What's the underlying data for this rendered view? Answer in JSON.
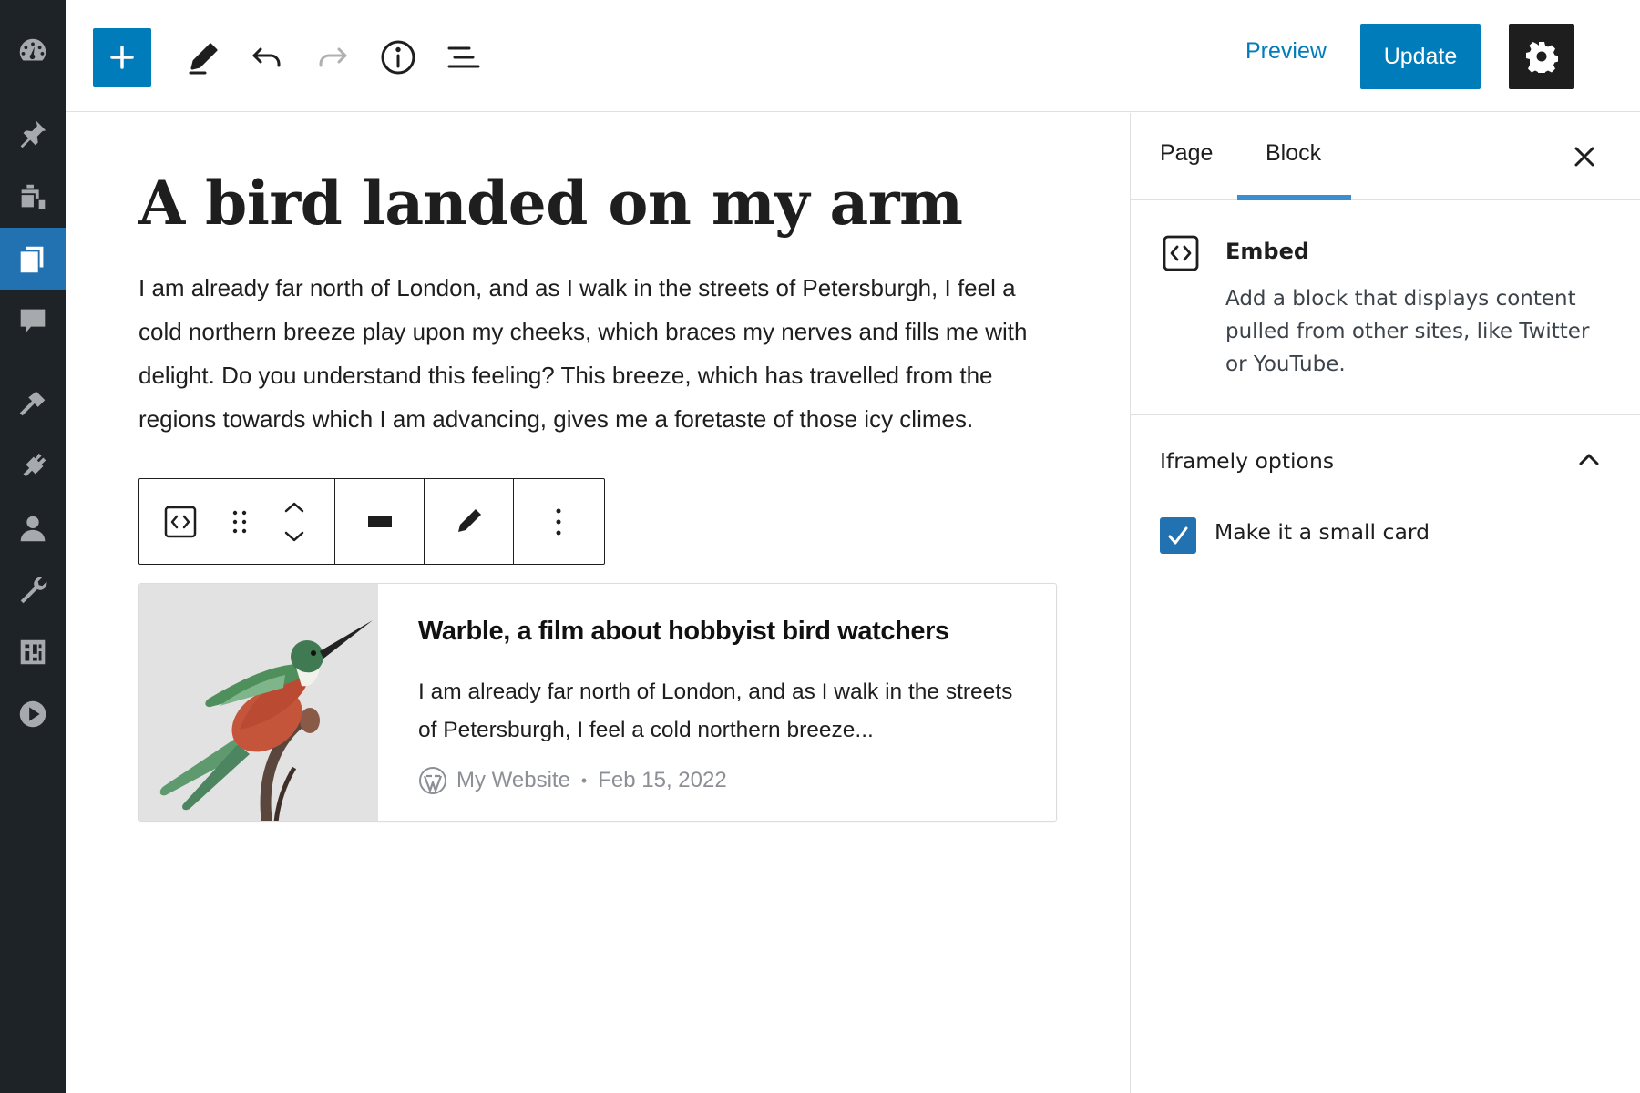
{
  "admin_menu": {
    "items": [
      {
        "name": "dashboard-icon",
        "active": false
      },
      {
        "name": "pin-icon",
        "active": false
      },
      {
        "name": "media-icon",
        "active": false
      },
      {
        "name": "pages-icon",
        "active": true
      },
      {
        "name": "comments-icon",
        "active": false
      },
      {
        "name": "appearance-icon",
        "active": false
      },
      {
        "name": "plugins-icon",
        "active": false
      },
      {
        "name": "users-icon",
        "active": false
      },
      {
        "name": "tools-icon",
        "active": false
      },
      {
        "name": "settings-icon",
        "active": false
      },
      {
        "name": "play-icon",
        "active": false
      }
    ]
  },
  "toolbar": {
    "add_icon": "plus-icon",
    "tools_icon": "pencil-icon",
    "undo_icon": "undo-icon",
    "redo_icon": "redo-icon",
    "details_icon": "info-icon",
    "outline_icon": "list-view-icon",
    "preview_label": "Preview",
    "update_label": "Update",
    "settings_icon": "gear-icon",
    "more_icon": "vertical-ellipsis-icon"
  },
  "editor": {
    "title": "A bird landed on my arm",
    "paragraph": "I am already far north of London, and as I walk in the streets of Petersburgh, I feel a cold northern breeze play upon my cheeks, which braces my nerves and fills me with delight. Do you understand this feeling? This breeze, which has travelled from the regions towards which I am advancing, gives me a foretaste of those icy climes.",
    "block_toolbar": [
      "embed-icon",
      "drag-handle-icon",
      "move-up-icon",
      "move-down-icon",
      "align-icon",
      "edit-icon",
      "more-options-icon"
    ]
  },
  "embed_card": {
    "title": "Warble, a film about hobbyist bird watchers",
    "description": "I am already far north of London, and as I walk in the streets of Petersburgh, I feel a cold northern breeze...",
    "site_name": "My Website",
    "separator": "•",
    "date": "Feb 15, 2022",
    "thumbnail": "hummingbird-image"
  },
  "sidebar": {
    "tabs": [
      {
        "label": "Page",
        "active": false
      },
      {
        "label": "Block",
        "active": true
      }
    ],
    "block": {
      "name": "Embed",
      "description": "Add a block that displays content pulled from other sites, like Twitter or YouTube."
    },
    "panel": {
      "title": "Iframely options",
      "expanded": true,
      "checkbox_label": "Make it a small card",
      "checkbox_checked": true
    }
  },
  "colors": {
    "accent": "#007cba",
    "admin_bg": "#1d2327",
    "admin_active": "#2271b1"
  }
}
